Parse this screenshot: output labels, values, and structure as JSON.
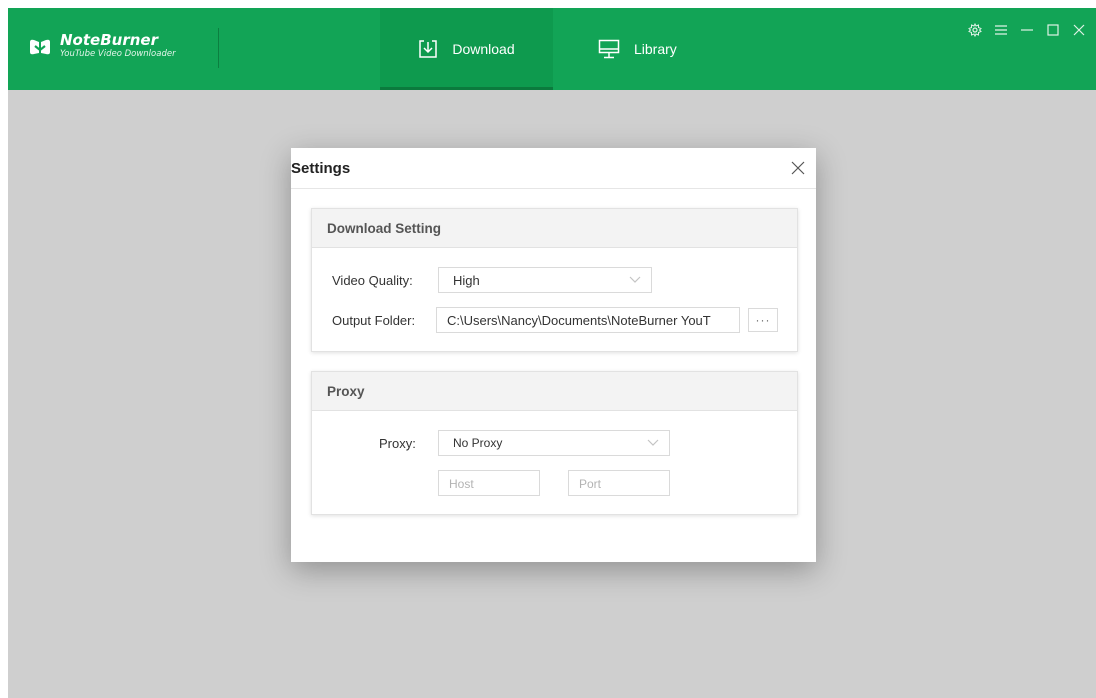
{
  "app": {
    "name": "NoteBurner",
    "subtitle": "YouTube Video Downloader",
    "accent_color": "#12a456"
  },
  "nav": {
    "tabs": [
      {
        "label": "Download",
        "icon": "download-icon",
        "active": true
      },
      {
        "label": "Library",
        "icon": "monitor-icon",
        "active": false
      }
    ]
  },
  "window_controls": [
    "settings-gear-icon",
    "menu-icon",
    "minimize-icon",
    "maximize-icon",
    "close-icon"
  ],
  "settings_dialog": {
    "title": "Settings",
    "download_setting": {
      "header": "Download Setting",
      "video_quality_label": "Video Quality:",
      "video_quality_value": "High",
      "output_folder_label": "Output Folder:",
      "output_folder_value": "C:\\Users\\Nancy\\Documents\\NoteBurner YouT",
      "browse_label": "···"
    },
    "proxy": {
      "header": "Proxy",
      "proxy_label": "Proxy:",
      "proxy_value": "No Proxy",
      "host_placeholder": "Host",
      "port_placeholder": "Port"
    }
  }
}
